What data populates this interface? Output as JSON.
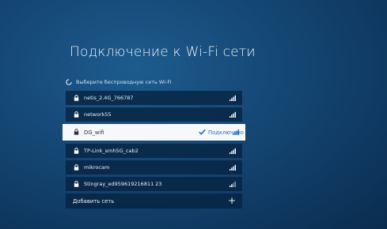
{
  "title": "Подключение к Wi-Fi сети",
  "subtitle": "Выберите беспроводную сеть Wi-Fi",
  "networks": [
    {
      "name": "netis_2.4G_766787"
    },
    {
      "name": "network55"
    },
    {
      "name": "DG_wifi",
      "status": "Подключено"
    },
    {
      "name": "TP-Link_smh5G_cab2"
    },
    {
      "name": "mikrocam"
    },
    {
      "name": "Stingray_ed959619216811 23"
    }
  ],
  "add_network": {
    "label": "Добавить сеть",
    "icon": "+"
  },
  "colors": {
    "accent": "#2c6fb7",
    "selected_bg": "#f6f8fa",
    "item_bg": "#062240"
  }
}
